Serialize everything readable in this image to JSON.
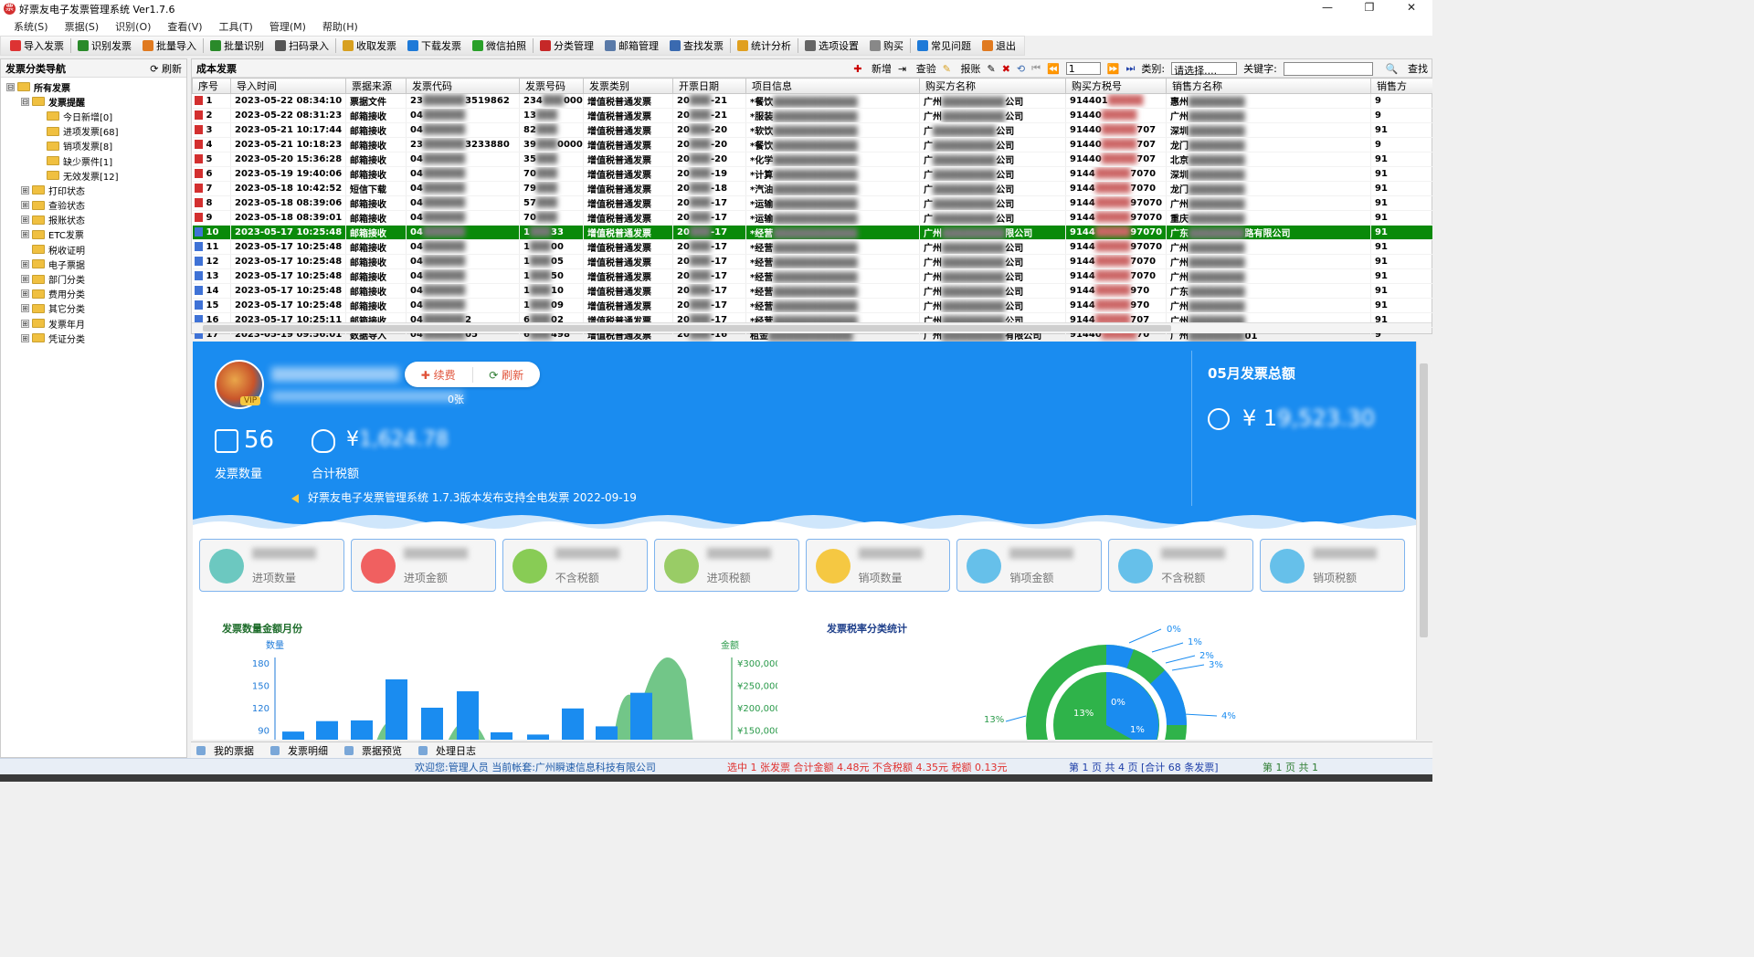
{
  "window": {
    "title": "好票友电子发票管理系统 Ver1.7.6",
    "controls": [
      "—",
      "❐",
      "✕"
    ]
  },
  "menu": [
    "系统(S)",
    "票据(S)",
    "识别(O)",
    "查看(V)",
    "工具(T)",
    "管理(M)",
    "帮助(H)"
  ],
  "toolbar": [
    {
      "label": "导入发票",
      "icon": "import-icon",
      "color": "#d33"
    },
    {
      "label": "识别发票",
      "icon": "scan-icon",
      "color": "#2a8a2a"
    },
    {
      "label": "批量导入",
      "icon": "batch-import-icon",
      "color": "#e07a20"
    },
    {
      "label": "批量识别",
      "icon": "batch-scan-icon",
      "color": "#2a8a2a"
    },
    {
      "label": "扫码录入",
      "icon": "qrcode-icon",
      "color": "#555"
    },
    {
      "label": "收取发票",
      "icon": "inbox-icon",
      "color": "#d8a020"
    },
    {
      "label": "下载发票",
      "icon": "download-icon",
      "color": "#1e7ad8"
    },
    {
      "label": "微信拍照",
      "icon": "wechat-icon",
      "color": "#2aa02a"
    },
    {
      "label": "分类管理",
      "icon": "category-icon",
      "color": "#c62828"
    },
    {
      "label": "邮箱管理",
      "icon": "mail-icon",
      "color": "#5a7aa8"
    },
    {
      "label": "查找发票",
      "icon": "find-icon",
      "color": "#3a6ab0"
    },
    {
      "label": "统计分析",
      "icon": "chart-icon",
      "color": "#e0a020"
    },
    {
      "label": "选项设置",
      "icon": "settings-icon",
      "color": "#666"
    },
    {
      "label": "购买",
      "icon": "cart-icon",
      "color": "#888"
    },
    {
      "label": "常见问题",
      "icon": "help-icon",
      "color": "#1e7ad8"
    },
    {
      "label": "退出",
      "icon": "exit-icon",
      "color": "#e07a20"
    }
  ],
  "nav": {
    "title": "发票分类导航",
    "refresh": "刷新",
    "items": [
      {
        "label": "所有发票",
        "level": 0,
        "exp": "⊟",
        "bold": true
      },
      {
        "label": "发票提醒",
        "level": 1,
        "exp": "⊟",
        "bold": true
      },
      {
        "label": "今日新增[0]",
        "level": 2
      },
      {
        "label": "进项发票[68]",
        "level": 2
      },
      {
        "label": "销项发票[8]",
        "level": 2
      },
      {
        "label": "缺少票件[1]",
        "level": 2
      },
      {
        "label": "无效发票[12]",
        "level": 2
      },
      {
        "label": "打印状态",
        "level": 1,
        "exp": "⊞"
      },
      {
        "label": "查验状态",
        "level": 1,
        "exp": "⊞"
      },
      {
        "label": "报账状态",
        "level": 1,
        "exp": "⊞"
      },
      {
        "label": "ETC发票",
        "level": 1,
        "exp": "⊞"
      },
      {
        "label": "税收证明",
        "level": 1
      },
      {
        "label": "电子票据",
        "level": 1,
        "exp": "⊞"
      },
      {
        "label": "部门分类",
        "level": 1,
        "exp": "⊞"
      },
      {
        "label": "费用分类",
        "level": 1,
        "exp": "⊞"
      },
      {
        "label": "其它分类",
        "level": 1,
        "exp": "⊞"
      },
      {
        "label": "发票年月",
        "level": 1,
        "exp": "⊞"
      },
      {
        "label": "凭证分类",
        "level": 1,
        "exp": "⊞"
      }
    ]
  },
  "grid": {
    "title": "成本发票",
    "tools": {
      "add": "新增",
      "verify": "查验",
      "reimburse": "报账",
      "page": "1",
      "type_label": "类别:",
      "type_value": "请选择....",
      "keyword_label": "关键字:",
      "search": "查找"
    },
    "columns": [
      "序号",
      "导入时间",
      "票据来源",
      "发票代码",
      "发票号码",
      "发票类别",
      "开票日期",
      "项目信息",
      "购买方名称",
      "购买方税号",
      "销售方名称",
      "销售方"
    ],
    "rows": [
      [
        "1",
        "2023-05-22 08:34:10",
        "票据文件",
        "23",
        "3519862",
        "234",
        "0000...",
        "增值税普通发票",
        "20",
        "-21",
        "*餐饮",
        "广州",
        "公司",
        "914401",
        "",
        "惠州",
        "",
        "9"
      ],
      [
        "2",
        "2023-05-22 08:31:23",
        "邮箱接收",
        "04",
        "",
        "13",
        "",
        "增值税普通发票",
        "20",
        "-21",
        "*服装",
        "广州",
        "公司",
        "91440",
        "",
        "广州",
        "",
        "9"
      ],
      [
        "3",
        "2023-05-21 10:17:44",
        "邮箱接收",
        "04",
        "",
        "82",
        "",
        "增值税普通发票",
        "20",
        "-20",
        "*软饮",
        "广",
        "公司",
        "91440",
        "707",
        "深圳",
        "",
        "91"
      ],
      [
        "4",
        "2023-05-21 10:18:23",
        "邮箱接收",
        "23",
        "3233880",
        "39",
        "0000...",
        "增值税普通发票",
        "20",
        "-20",
        "*餐饮",
        "广",
        "公司",
        "91440",
        "707",
        "龙门",
        "",
        "9"
      ],
      [
        "5",
        "2023-05-20 15:36:28",
        "邮箱接收",
        "04",
        "",
        "35",
        "",
        "增值税普通发票",
        "20",
        "-20",
        "*化学",
        "广",
        "公司",
        "91440",
        "707",
        "北京",
        "",
        "91"
      ],
      [
        "6",
        "2023-05-19 19:40:06",
        "邮箱接收",
        "04",
        "",
        "70",
        "",
        "增值税普通发票",
        "20",
        "-19",
        "*计算",
        "广",
        "公司",
        "9144",
        "7070",
        "深圳",
        "",
        "91"
      ],
      [
        "7",
        "2023-05-18 10:42:52",
        "短信下载",
        "04",
        "",
        "79",
        "",
        "增值税普通发票",
        "20",
        "-18",
        "*汽油",
        "广",
        "公司",
        "9144",
        "7070",
        "龙门",
        "",
        "91"
      ],
      [
        "8",
        "2023-05-18 08:39:06",
        "邮箱接收",
        "04",
        "",
        "57",
        "",
        "增值税普通发票",
        "20",
        "-17",
        "*运输",
        "广",
        "公司",
        "9144",
        "97070",
        "广州",
        "",
        "91"
      ],
      [
        "9",
        "2023-05-18 08:39:01",
        "邮箱接收",
        "04",
        "",
        "70",
        "",
        "增值税普通发票",
        "20",
        "-17",
        "*运输",
        "广",
        "公司",
        "9144",
        "97070",
        "重庆",
        "",
        "91"
      ],
      [
        "10",
        "2023-05-17 10:25:48",
        "邮箱接收",
        "04",
        "",
        "1",
        "33",
        "增值税普通发票",
        "20",
        "-17",
        "*经营",
        "广州",
        "限公司",
        "9144",
        "97070",
        "广东",
        "路有限公司",
        "91"
      ],
      [
        "11",
        "2023-05-17 10:25:48",
        "邮箱接收",
        "04",
        "",
        "1",
        "00",
        "增值税普通发票",
        "20",
        "-17",
        "*经营",
        "广州",
        "公司",
        "9144",
        "97070",
        "广州",
        "",
        "91"
      ],
      [
        "12",
        "2023-05-17 10:25:48",
        "邮箱接收",
        "04",
        "",
        "1",
        "05",
        "增值税普通发票",
        "20",
        "-17",
        "*经营",
        "广州",
        "公司",
        "9144",
        "7070",
        "广州",
        "",
        "91"
      ],
      [
        "13",
        "2023-05-17 10:25:48",
        "邮箱接收",
        "04",
        "",
        "1",
        "50",
        "增值税普通发票",
        "20",
        "-17",
        "*经营",
        "广州",
        "公司",
        "9144",
        "7070",
        "广州",
        "",
        "91"
      ],
      [
        "14",
        "2023-05-17 10:25:48",
        "邮箱接收",
        "04",
        "",
        "1",
        "10",
        "增值税普通发票",
        "20",
        "-17",
        "*经营",
        "广州",
        "公司",
        "9144",
        "970",
        "广东",
        "",
        "91"
      ],
      [
        "15",
        "2023-05-17 10:25:48",
        "邮箱接收",
        "04",
        "",
        "1",
        "09",
        "增值税普通发票",
        "20",
        "-17",
        "*经营",
        "广州",
        "公司",
        "9144",
        "970",
        "广州",
        "",
        "91"
      ],
      [
        "16",
        "2023-05-17 10:25:11",
        "邮箱接收",
        "04",
        "2",
        "6",
        "02",
        "增值税普通发票",
        "20",
        "-17",
        "*经营",
        "广州",
        "公司",
        "9144",
        "707",
        "广州",
        "",
        "91"
      ],
      [
        "17",
        "2023-05-19 09:56:01",
        "数据导入",
        "04",
        "05",
        "6",
        "498",
        "增值税普通发票",
        "20",
        "-16",
        "租金",
        "广州",
        "有限公司",
        "91440",
        "70",
        "广州",
        "01",
        "9"
      ]
    ],
    "selected_row": 10
  },
  "dashboard": {
    "renew": "续费",
    "refresh": "刷新",
    "vip": "VIP",
    "user_sub_suffix": "0张",
    "invoice_count": "56",
    "invoice_count_label": "发票数量",
    "tax_total_prefix": "¥",
    "tax_total_label": "合计税额",
    "notice": "好票友电子发票管理系统 1.7.3版本发布支持全电发票 2022-09-19",
    "month_title": "05月发票总额",
    "month_total_prefix": "¥ 1",
    "cards": [
      {
        "label": "进项数量",
        "color": "#6cc8c0"
      },
      {
        "label": "进项金额",
        "color": "#f06060"
      },
      {
        "label": "不含税额",
        "color": "#88cc55"
      },
      {
        "label": "进项税额",
        "color": "#99cc66"
      },
      {
        "label": "销项数量",
        "color": "#f5c842"
      },
      {
        "label": "销项金额",
        "color": "#66c0ea"
      },
      {
        "label": "不含税额",
        "color": "#66c0ea"
      },
      {
        "label": "销项税额",
        "color": "#66c0ea"
      }
    ]
  },
  "chart_data": [
    {
      "type": "bar",
      "title": "发票数量金额月份",
      "ylabel": "数量",
      "y2label": "金额",
      "ylim": [
        90,
        180
      ],
      "yticks": [
        "180",
        "150",
        "120",
        "90"
      ],
      "y2ticks": [
        "¥300,000",
        "¥250,000",
        "¥200,000",
        "¥150,000"
      ],
      "series": [
        {
          "values": [
            88,
            102,
            103,
            158,
            120,
            142,
            87,
            84,
            119,
            95,
            140
          ]
        }
      ]
    },
    {
      "type": "pie",
      "title": "发票税率分类统计",
      "labels": [
        "0%",
        "1%",
        "2%",
        "3%",
        "4%",
        "13%"
      ],
      "inner_labels": [
        "13%",
        "0%",
        "1%"
      ]
    }
  ],
  "bottom_tabs": [
    "我的票据",
    "发票明细",
    "票据预览",
    "处理日志"
  ],
  "status": {
    "login": "欢迎您:管理人员 当前帐套:广州瞬速信息科技有限公司",
    "selection": "选中 1 张发票 合计金额 4.48元 不含税额 4.35元 税额 0.13元",
    "pagination": "第 1 页 共 4 页 [合计 68 条发票]",
    "pagination2": "第 1 页 共 1"
  }
}
